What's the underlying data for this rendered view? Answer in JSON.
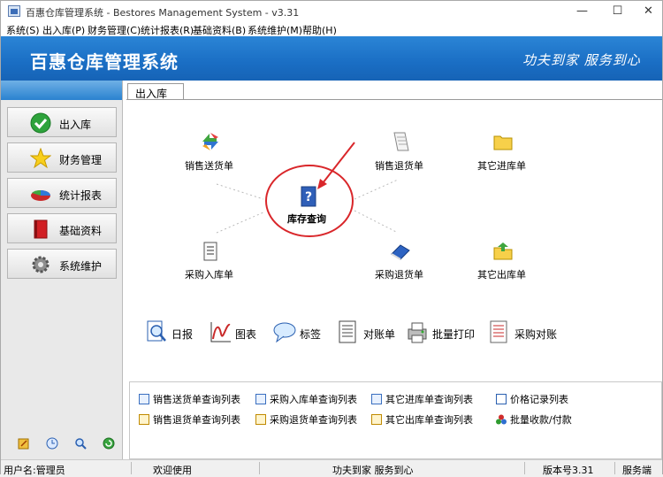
{
  "window": {
    "title": "百惠仓库管理系统 - Bestores Management System - v3.31",
    "min": "—",
    "max": "☐",
    "close": "✕"
  },
  "menu": [
    "系统(S)",
    "出入库(P)",
    "财务管理(C)",
    "统计报表(R)",
    "基础资料(B)",
    "系统维护(M)",
    "帮助(H)"
  ],
  "banner": {
    "title": "百惠仓库管理系统",
    "slogan": "功夫到家 服务到心"
  },
  "nav": [
    {
      "label": "出入库",
      "icon": "green-checkmark-icon"
    },
    {
      "label": "财务管理",
      "icon": "star-icon"
    },
    {
      "label": "统计报表",
      "icon": "pie-chart-icon"
    },
    {
      "label": "基础资料",
      "icon": "book-icon"
    },
    {
      "label": "系统维护",
      "icon": "gear-icon"
    }
  ],
  "tab": {
    "label": "出入库"
  },
  "flow": {
    "sales_delivery": "销售送货单",
    "sales_return": "销售退货单",
    "other_in": "其它进库单",
    "stock_query": "库存查询",
    "purchase_in": "采购入库单",
    "purchase_return": "采购退货单",
    "other_out": "其它出库单"
  },
  "tools": [
    "日报",
    "图表",
    "标签",
    "对账单",
    "批量打印",
    "采购对账"
  ],
  "lists": [
    [
      "销售送货单查询列表",
      "采购入库单查询列表",
      "其它进库单查询列表",
      "价格记录列表"
    ],
    [
      "销售退货单查询列表",
      "采购退货单查询列表",
      "其它出库单查询列表",
      "批量收款/付款"
    ]
  ],
  "status": {
    "user": "用户名:管理员",
    "welcome": "欢迎使用",
    "slogan": "功夫到家 服务到心",
    "version": "版本号3.31",
    "server": "服务端"
  },
  "colors": {
    "banner": "#1a6ec4",
    "highlight_circle": "#d9262a"
  }
}
